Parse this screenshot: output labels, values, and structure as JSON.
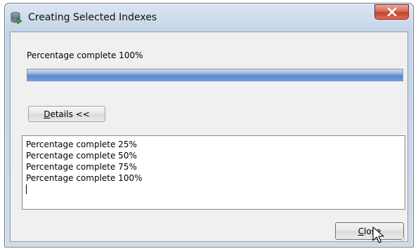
{
  "window": {
    "title": "Creating Selected Indexes",
    "title_icon": "database-create-icon"
  },
  "progress": {
    "label": "Percentage complete 100%",
    "percent": 100,
    "color": "#5a8ad0"
  },
  "details_button": {
    "label_mnemonic": "D",
    "label_rest": "etails <<"
  },
  "log": {
    "lines": [
      "Percentage complete 25%",
      "Percentage complete 50%",
      "Percentage complete 75%",
      "Percentage complete 100%"
    ]
  },
  "close_button": {
    "label_mnemonic": "C",
    "label_rest": "lose"
  },
  "colors": {
    "close_x": "#c2432c",
    "frame": "#c4d4e6"
  }
}
